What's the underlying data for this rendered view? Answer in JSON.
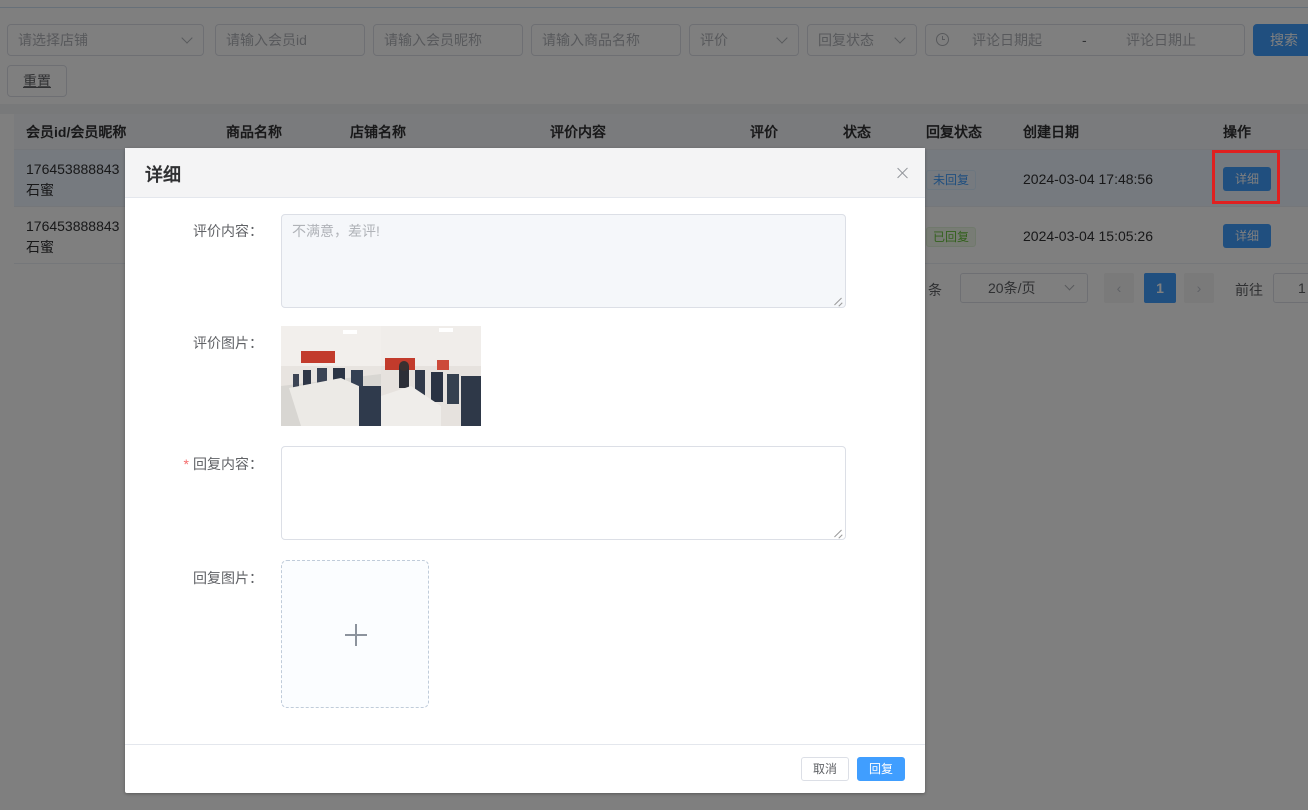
{
  "filters": {
    "store_placeholder": "请选择店铺",
    "member_id_placeholder": "请输入会员id",
    "nickname_placeholder": "请输入会员昵称",
    "product_placeholder": "请输入商品名称",
    "rating_placeholder": "评价",
    "reply_status_placeholder": "回复状态",
    "date_start_placeholder": "评论日期起",
    "date_separator": "-",
    "date_end_placeholder": "评论日期止",
    "search_label": "搜索",
    "reset_label": "重置"
  },
  "table": {
    "columns": [
      "会员id/会员昵称",
      "商品名称",
      "店铺名称",
      "评价内容",
      "评价",
      "状态",
      "回复状态",
      "创建日期",
      "操作"
    ],
    "rows": [
      {
        "member_id": "176453888843",
        "nickname": "石蜜",
        "reply_status": "未回复",
        "created": "2024-03-04 17:48:56",
        "action": "详细"
      },
      {
        "member_id": "176453888843",
        "nickname": "石蜜",
        "reply_status": "已回复",
        "created": "2024-03-04 15:05:26",
        "action": "详细"
      }
    ]
  },
  "pagination": {
    "total_suffix": "条",
    "page_size": "20条/页",
    "prev": "‹",
    "current_page": "1",
    "next": "›",
    "goto_label": "前往",
    "goto_value": "1"
  },
  "dialog": {
    "title": "详细",
    "review_content_label": "评价内容：",
    "review_content_value": "不满意，差评!",
    "review_images_label": "评价图片：",
    "reply_content_required_mark": "*",
    "reply_content_label": "回复内容：",
    "reply_content_value": "",
    "reply_images_label": "回复图片：",
    "cancel_label": "取消",
    "reply_label": "回复"
  },
  "colors": {
    "primary": "#409eff",
    "highlight_box": "#e02020",
    "required": "#f56c6c",
    "success_tag": "#67c23a"
  },
  "icons": [
    "chevron-down-icon",
    "clock-icon",
    "close-icon",
    "plus-icon",
    "chevron-left-icon",
    "chevron-right-icon"
  ]
}
